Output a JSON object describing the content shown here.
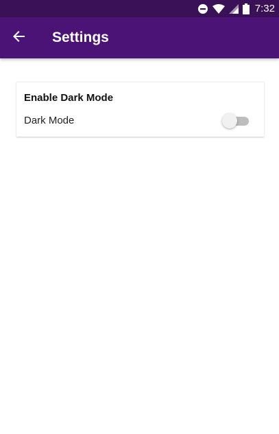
{
  "status_bar": {
    "time": "7:32",
    "icons": [
      "do-not-disturb-icon",
      "wifi-icon",
      "cell-signal-icon",
      "battery-icon"
    ]
  },
  "app_bar": {
    "title": "Settings",
    "back_icon": "arrow-back-icon",
    "color": "#4a1375"
  },
  "settings": {
    "section_title": "Enable Dark Mode",
    "dark_mode": {
      "label": "Dark Mode",
      "enabled": false
    }
  },
  "colors": {
    "status_bar": "#3a1057",
    "app_bar": "#4a1375",
    "background": "#ffffff"
  }
}
